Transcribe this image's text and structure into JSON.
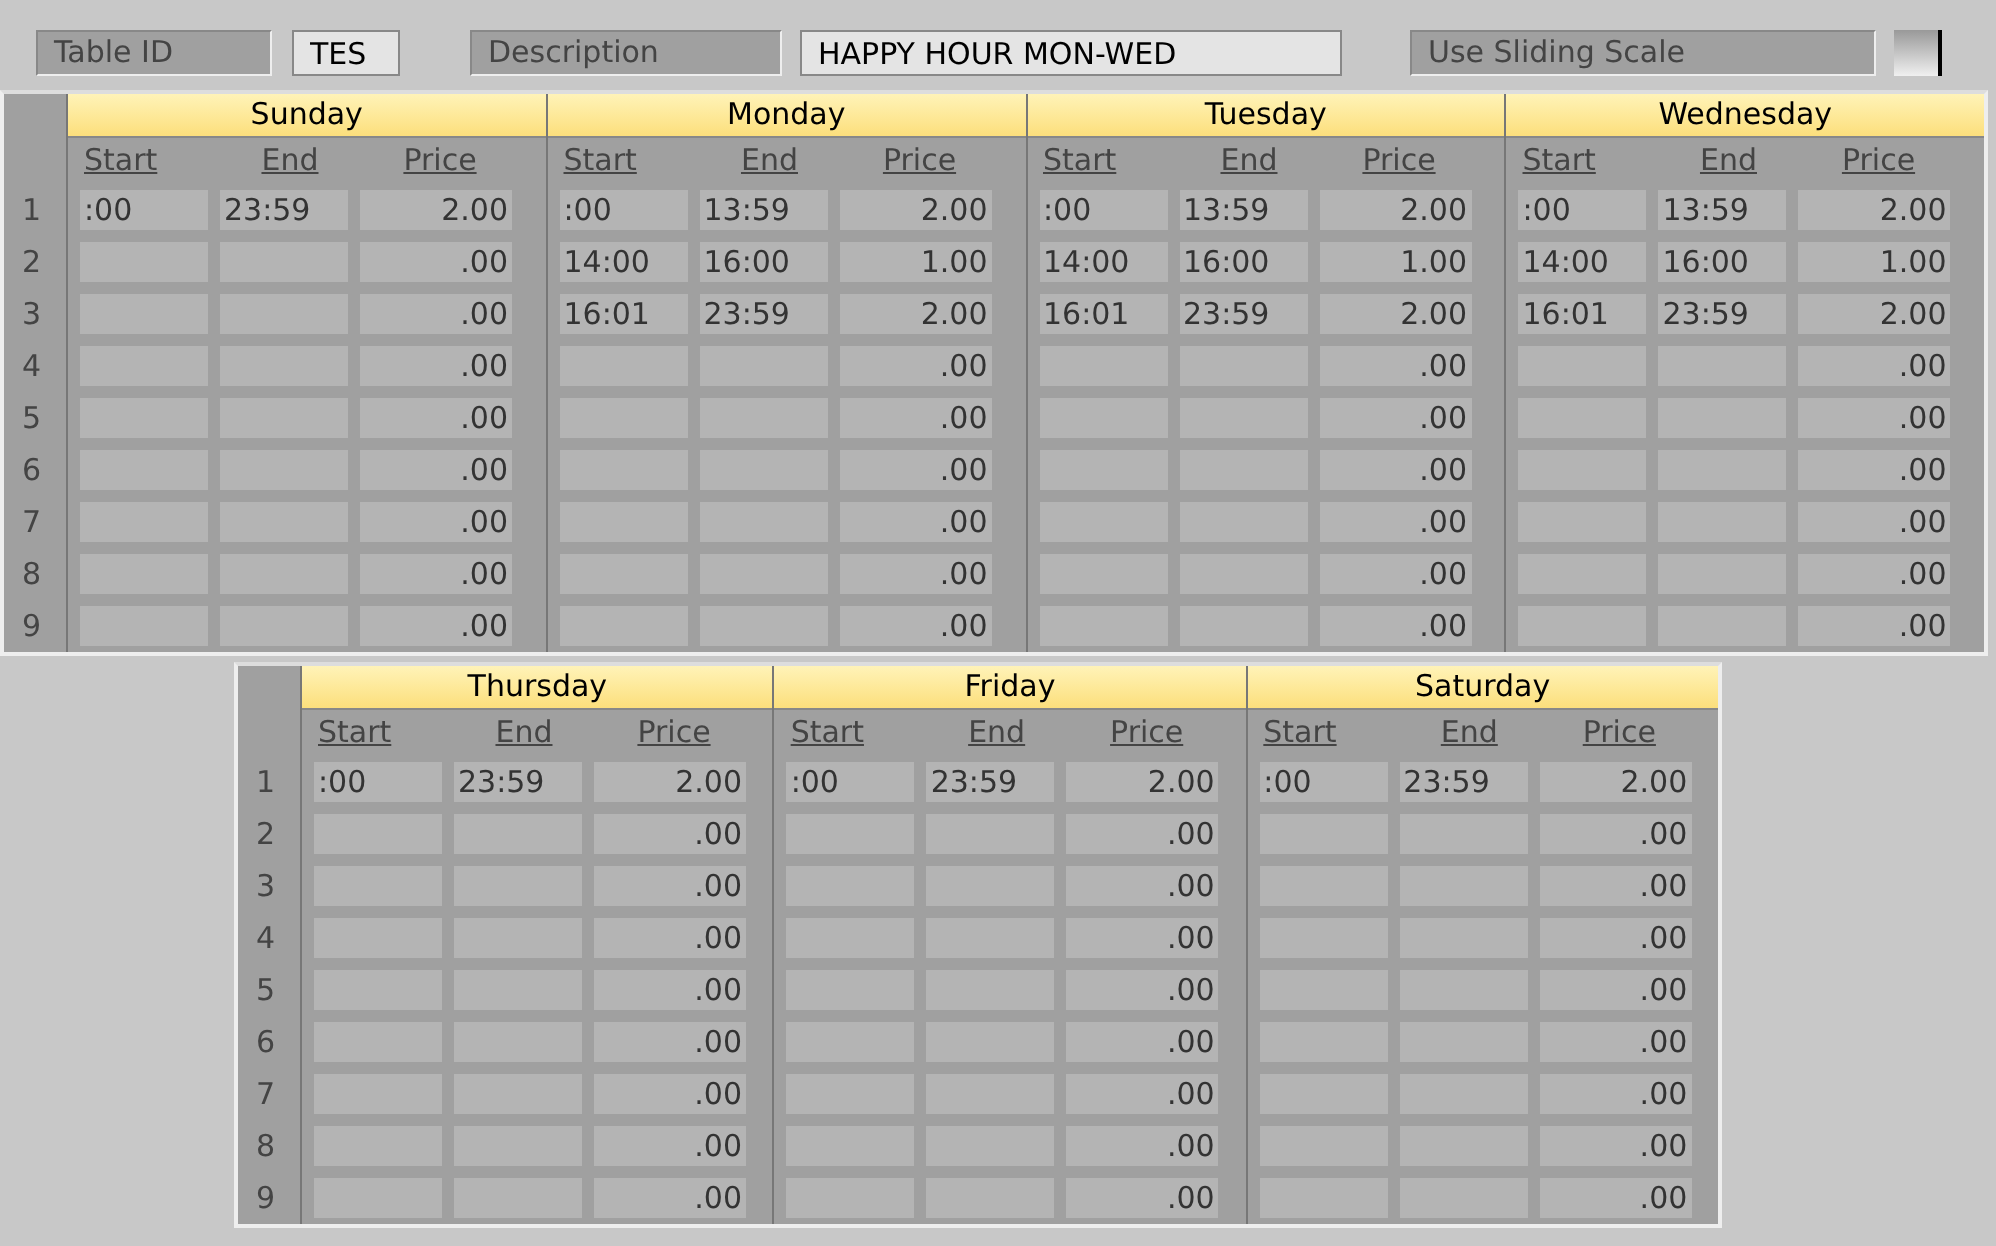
{
  "header": {
    "table_id_label": "Table ID",
    "table_id": "TES",
    "description_label": "Description",
    "description": "HAPPY HOUR MON-WED",
    "sliding_scale_label": "Use Sliding Scale",
    "sliding_scale_checked": false
  },
  "grids": [
    {
      "row_numbers": [
        "1",
        "2",
        "3",
        "4",
        "5",
        "6",
        "7",
        "8",
        "9"
      ],
      "days": [
        {
          "name": "Sunday",
          "columns": [
            "Start",
            "End",
            "Price"
          ],
          "rows": [
            {
              "start": ":00",
              "end": "23:59",
              "price": "2.00"
            },
            {
              "price": ".00"
            },
            {
              "price": ".00"
            },
            {
              "price": ".00"
            },
            {
              "price": ".00"
            },
            {
              "price": ".00"
            },
            {
              "price": ".00"
            },
            {
              "price": ".00"
            },
            {
              "price": ".00"
            }
          ]
        },
        {
          "name": "Monday",
          "columns": [
            "Start",
            "End",
            "Price"
          ],
          "rows": [
            {
              "start": ":00",
              "end": "13:59",
              "price": "2.00"
            },
            {
              "start": "14:00",
              "end": "16:00",
              "price": "1.00"
            },
            {
              "start": "16:01",
              "end": "23:59",
              "price": "2.00"
            },
            {
              "price": ".00"
            },
            {
              "price": ".00"
            },
            {
              "price": ".00"
            },
            {
              "price": ".00"
            },
            {
              "price": ".00"
            },
            {
              "price": ".00"
            }
          ]
        },
        {
          "name": "Tuesday",
          "columns": [
            "Start",
            "End",
            "Price"
          ],
          "rows": [
            {
              "start": ":00",
              "end": "13:59",
              "price": "2.00"
            },
            {
              "start": "14:00",
              "end": "16:00",
              "price": "1.00"
            },
            {
              "start": "16:01",
              "end": "23:59",
              "price": "2.00"
            },
            {
              "price": ".00"
            },
            {
              "price": ".00"
            },
            {
              "price": ".00"
            },
            {
              "price": ".00"
            },
            {
              "price": ".00"
            },
            {
              "price": ".00"
            }
          ]
        },
        {
          "name": "Wednesday",
          "columns": [
            "Start",
            "End",
            "Price"
          ],
          "rows": [
            {
              "start": ":00",
              "end": "13:59",
              "price": "2.00"
            },
            {
              "start": "14:00",
              "end": "16:00",
              "price": "1.00"
            },
            {
              "start": "16:01",
              "end": "23:59",
              "price": "2.00"
            },
            {
              "price": ".00"
            },
            {
              "price": ".00"
            },
            {
              "price": ".00"
            },
            {
              "price": ".00"
            },
            {
              "price": ".00"
            },
            {
              "price": ".00"
            }
          ]
        }
      ]
    },
    {
      "row_numbers": [
        "1",
        "2",
        "3",
        "4",
        "5",
        "6",
        "7",
        "8",
        "9"
      ],
      "days": [
        {
          "name": "Thursday",
          "columns": [
            "Start",
            "End",
            "Price"
          ],
          "rows": [
            {
              "start": ":00",
              "end": "23:59",
              "price": "2.00"
            },
            {
              "price": ".00"
            },
            {
              "price": ".00"
            },
            {
              "price": ".00"
            },
            {
              "price": ".00"
            },
            {
              "price": ".00"
            },
            {
              "price": ".00"
            },
            {
              "price": ".00"
            },
            {
              "price": ".00"
            }
          ]
        },
        {
          "name": "Friday",
          "columns": [
            "Start",
            "End",
            "Price"
          ],
          "rows": [
            {
              "start": ":00",
              "end": "23:59",
              "price": "2.00"
            },
            {
              "price": ".00"
            },
            {
              "price": ".00"
            },
            {
              "price": ".00"
            },
            {
              "price": ".00"
            },
            {
              "price": ".00"
            },
            {
              "price": ".00"
            },
            {
              "price": ".00"
            },
            {
              "price": ".00"
            }
          ]
        },
        {
          "name": "Saturday",
          "columns": [
            "Start",
            "End",
            "Price"
          ],
          "rows": [
            {
              "start": ":00",
              "end": "23:59",
              "price": "2.00"
            },
            {
              "price": ".00"
            },
            {
              "price": ".00"
            },
            {
              "price": ".00"
            },
            {
              "price": ".00"
            },
            {
              "price": ".00"
            },
            {
              "price": ".00"
            },
            {
              "price": ".00"
            },
            {
              "price": ".00"
            }
          ]
        }
      ]
    }
  ]
}
